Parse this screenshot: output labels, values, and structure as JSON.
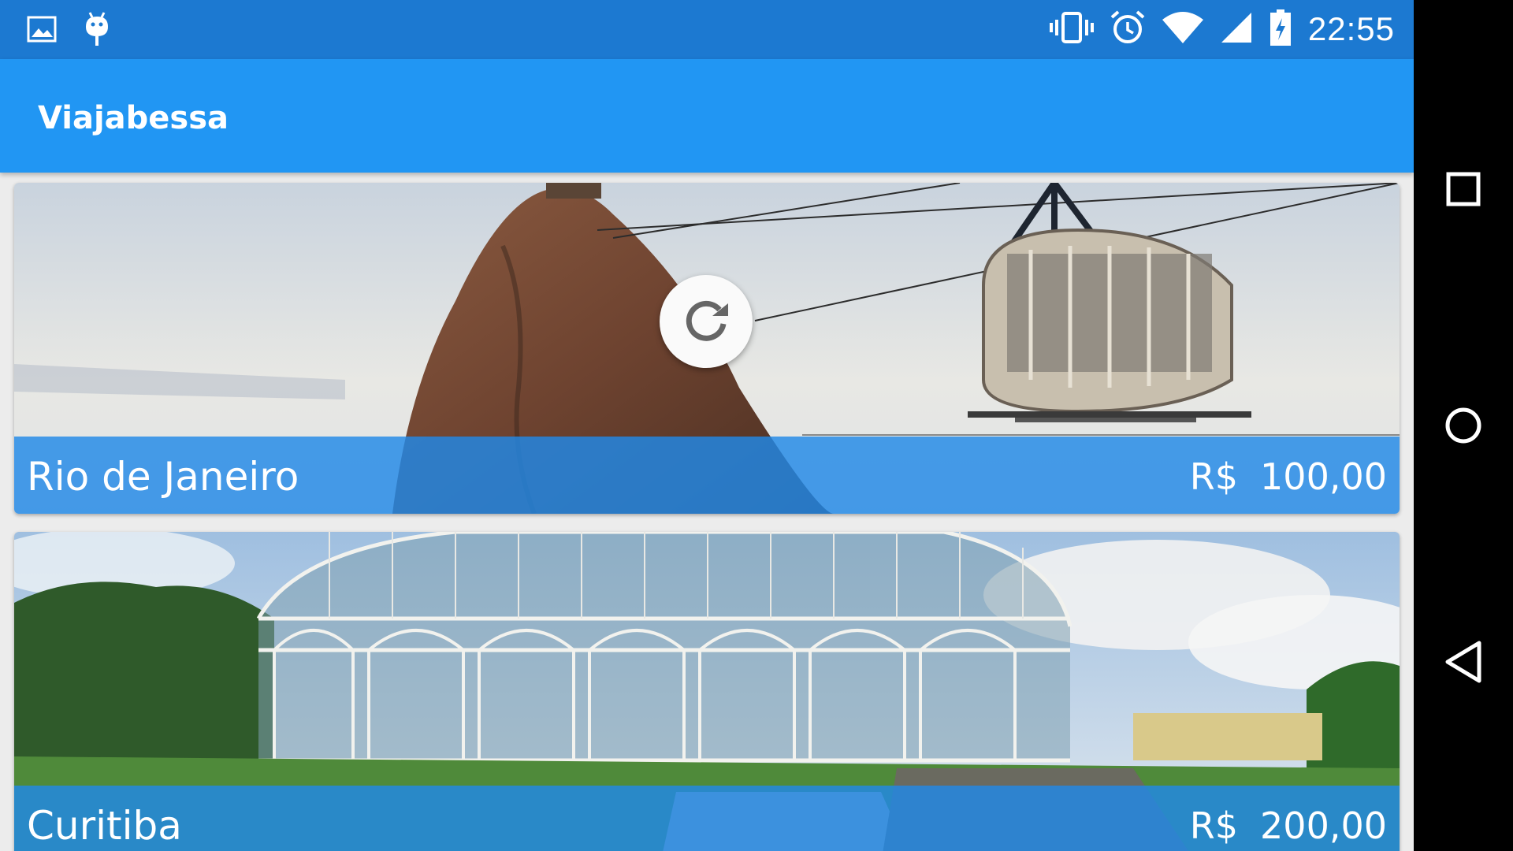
{
  "status_bar": {
    "time": "22:55",
    "left_icons": [
      "image-icon",
      "android-debug-icon"
    ],
    "right_icons": [
      "vibrate-icon",
      "alarm-icon",
      "wifi-icon",
      "signal-icon",
      "battery-charging-icon"
    ]
  },
  "app_bar": {
    "title": "Viajabessa"
  },
  "packages": [
    {
      "name": "Rio de Janeiro",
      "currency": "R$",
      "price": "100,00",
      "image": "sugarloaf-cable-car-photo"
    },
    {
      "name": "Curitiba",
      "currency": "R$",
      "price": "200,00",
      "image": "botanical-garden-greenhouse-photo"
    }
  ],
  "refresh_indicator": {
    "icon": "refresh-icon"
  },
  "navigation_bar": {
    "buttons": [
      "recents-button",
      "home-button",
      "back-button"
    ]
  },
  "colors": {
    "status_bar": "#1c79d1",
    "app_bar": "#2196f3",
    "card_footer": "#2189e8"
  }
}
